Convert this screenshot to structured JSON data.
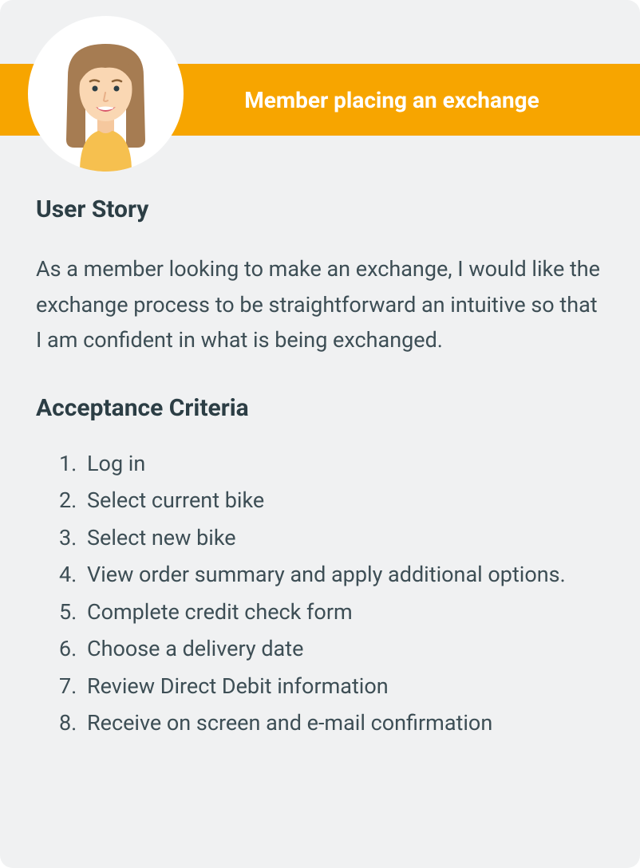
{
  "header": {
    "title": "Member placing an exchange"
  },
  "userStory": {
    "heading": "User Story",
    "text": "As a member looking to make an exchange, I would like the exchange process to be straightforward an intuitive so that I am confident in what is being exchanged."
  },
  "acceptanceCriteria": {
    "heading": "Acceptance Criteria",
    "items": [
      "Log in",
      "Select current bike",
      "Select new bike",
      "View order summary and apply additional options.",
      "Complete credit check form",
      "Choose a delivery date",
      "Review Direct Debit information",
      "Receive on screen and e-mail confirmation"
    ]
  }
}
